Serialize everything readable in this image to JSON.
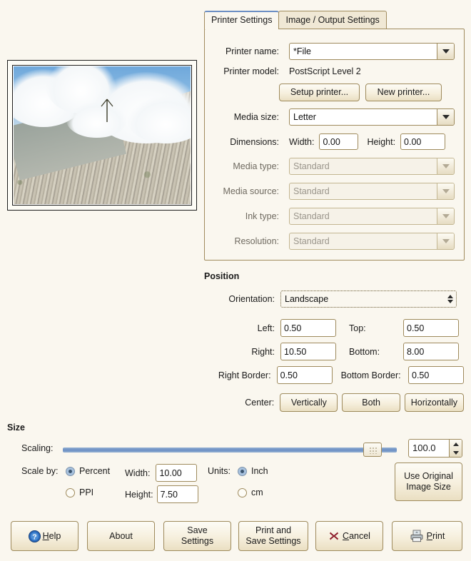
{
  "tabs": [
    {
      "label": "Printer Settings",
      "active": true
    },
    {
      "label": "Image / Output Settings",
      "active": false
    }
  ],
  "printer_settings": {
    "printer_name": {
      "label": "Printer name:",
      "value": "*File"
    },
    "printer_model": {
      "label": "Printer model:",
      "value": "PostScript Level 2"
    },
    "setup_printer_button": "Setup printer...",
    "new_printer_button": "New printer...",
    "media_size": {
      "label": "Media size:",
      "value": "Letter"
    },
    "dimensions": {
      "label": "Dimensions:",
      "width_label": "Width:",
      "width_value": "0.00",
      "height_label": "Height:",
      "height_value": "0.00"
    },
    "media_type": {
      "label": "Media type:",
      "value": "Standard",
      "disabled": true
    },
    "media_source": {
      "label": "Media source:",
      "value": "Standard",
      "disabled": true
    },
    "ink_type": {
      "label": "Ink type:",
      "value": "Standard",
      "disabled": true
    },
    "resolution": {
      "label": "Resolution:",
      "value": "Standard",
      "disabled": true
    }
  },
  "position": {
    "title": "Position",
    "orientation": {
      "label": "Orientation:",
      "value": "Landscape"
    },
    "left": {
      "label": "Left:",
      "value": "0.50"
    },
    "top": {
      "label": "Top:",
      "value": "0.50"
    },
    "right": {
      "label": "Right:",
      "value": "10.50"
    },
    "bottom": {
      "label": "Bottom:",
      "value": "8.00"
    },
    "right_border": {
      "label": "Right Border:",
      "value": "0.50"
    },
    "bottom_border": {
      "label": "Bottom Border:",
      "value": "0.50"
    },
    "center": {
      "label": "Center:",
      "vertically": "Vertically",
      "both": "Both",
      "horizontally": "Horizontally"
    }
  },
  "size": {
    "title": "Size",
    "scaling": {
      "label": "Scaling:",
      "value": "100.0",
      "slider_percent": 95.3,
      "min": 0,
      "max": 100
    },
    "scale_by": {
      "label": "Scale by:",
      "options": [
        {
          "label": "Percent",
          "selected": true
        },
        {
          "label": "PPI",
          "selected": false
        }
      ]
    },
    "width": {
      "label": "Width:",
      "value": "10.00"
    },
    "height": {
      "label": "Height:",
      "value": "7.50"
    },
    "units": {
      "label": "Units:",
      "options": [
        {
          "label": "Inch",
          "selected": true
        },
        {
          "label": "cm",
          "selected": false
        }
      ]
    },
    "use_original_button": {
      "line1": "Use Original",
      "line2": "Image Size"
    }
  },
  "action_buttons": {
    "help": "Help",
    "about": "About",
    "save_settings_l1": "Save",
    "save_settings_l2": "Settings",
    "print_and_save_l1": "Print and",
    "print_and_save_l2": "Save Settings",
    "cancel": "Cancel",
    "print": "Print"
  },
  "preview": {
    "description": "Print preview: photograph of a rocky mountain scree slope with clouds and blue sky",
    "orientation_indicator": "up-arrow"
  },
  "colors": {
    "page_bg": "#faf7ef",
    "panel_border": "#a08b5d",
    "tab_inactive": "#f0e8d5",
    "accent_blue": "#6b8ec4",
    "slider_blue": "#6b8ec4",
    "help_icon_blue": "#2a6bbf",
    "cancel_icon_red": "#8e1b2a",
    "disabled_text": "#9a958b"
  }
}
